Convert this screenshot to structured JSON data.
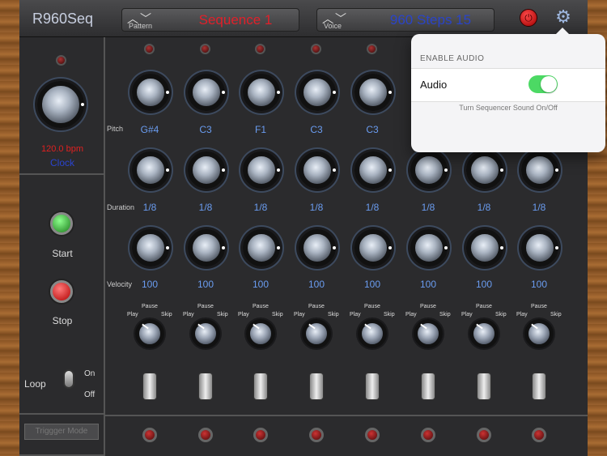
{
  "app": {
    "title": "R960Seq"
  },
  "pattern": {
    "label": "Pattern",
    "value": "Sequence 1"
  },
  "voice": {
    "label": "Voice",
    "value": "960 Steps 15"
  },
  "clock": {
    "bpm": "120.0 bpm",
    "label": "Clock"
  },
  "transport": {
    "start": "Start",
    "stop": "Stop"
  },
  "loop": {
    "label": "Loop",
    "on": "On",
    "off": "Off"
  },
  "trigger": {
    "label": "Triggger Mode"
  },
  "rows": {
    "pitch": "Pitch",
    "duration": "Duration",
    "velocity": "Velocity"
  },
  "modes": {
    "pause": "Pause",
    "play": "Play",
    "skip": "Skip"
  },
  "steps": {
    "pitch": [
      "G#4",
      "C3",
      "F1",
      "C3",
      "C3",
      "",
      "",
      ""
    ],
    "duration": [
      "1/8",
      "1/8",
      "1/8",
      "1/8",
      "1/8",
      "1/8",
      "1/8",
      "1/8"
    ],
    "velocity": [
      "100",
      "100",
      "100",
      "100",
      "100",
      "100",
      "100",
      "100"
    ]
  },
  "popover": {
    "header": "ENABLE AUDIO",
    "cell_label": "Audio",
    "audio_enabled": true,
    "footer": "Turn Sequencer Sound On/Off"
  },
  "colors": {
    "pattern": "#e0202a",
    "voice": "#2a44c8",
    "step_text": "#6a9cf0",
    "switch_on": "#4cd964"
  }
}
